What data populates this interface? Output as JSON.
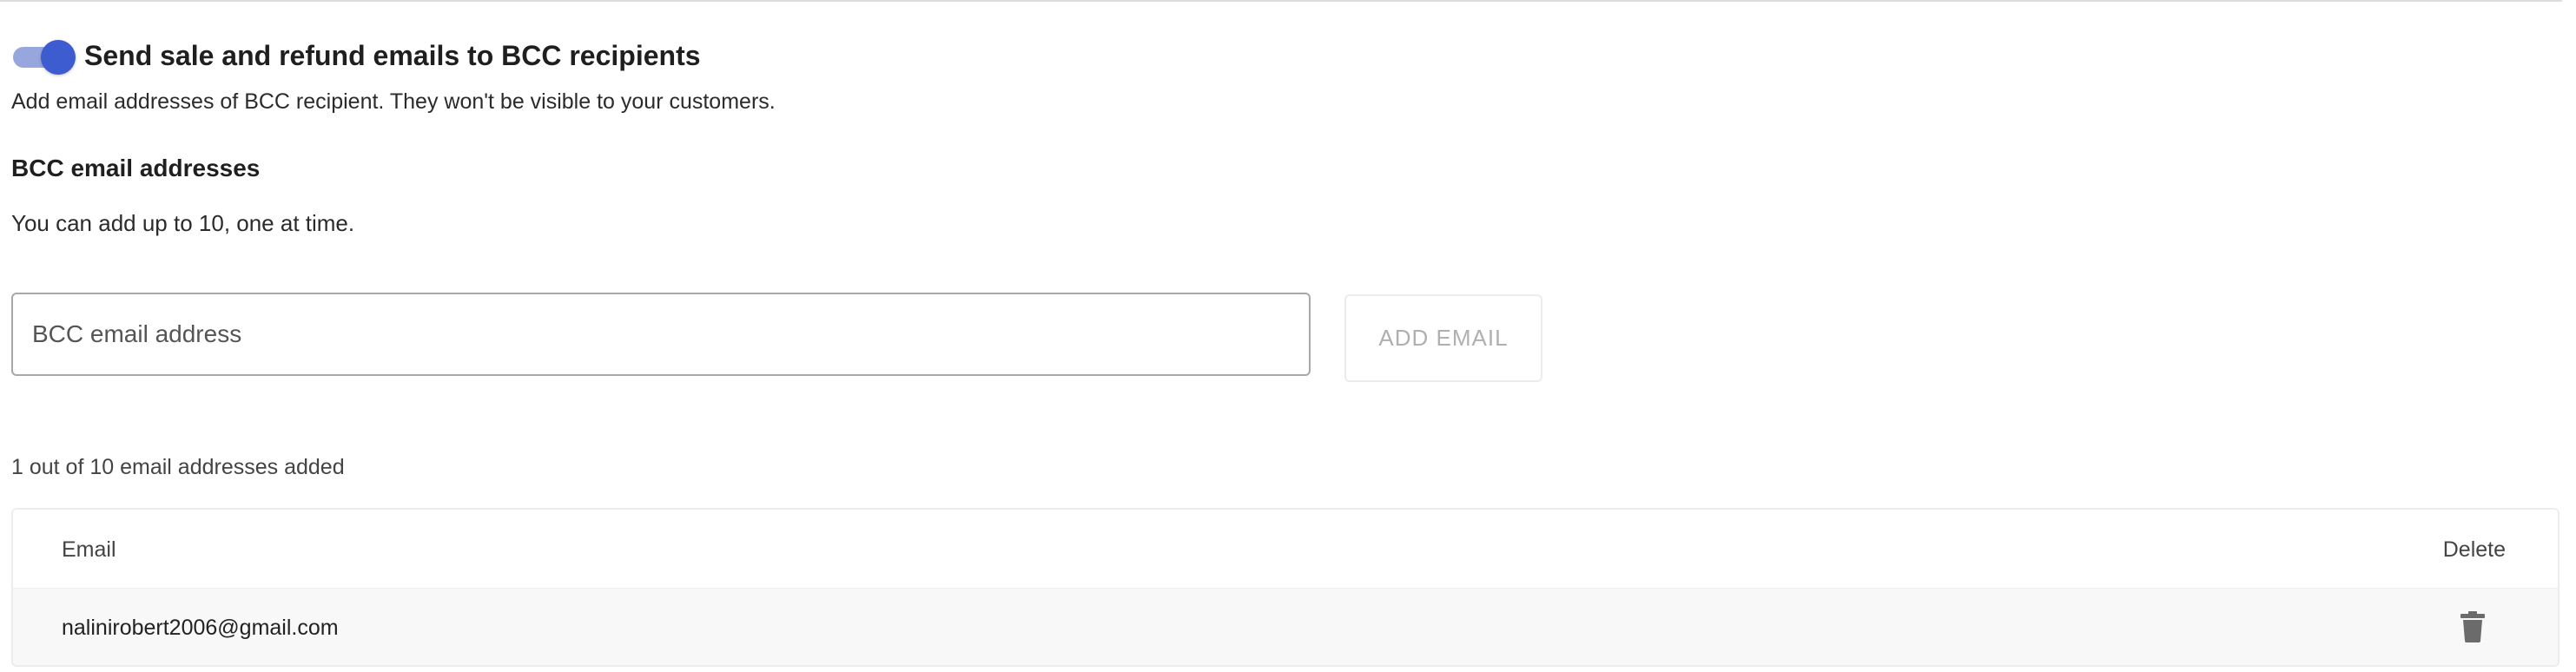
{
  "bcc_setting": {
    "toggle_on": true,
    "title": "Send sale and refund emails to BCC recipients",
    "description": "Add email addresses of BCC recipient. They won't be visible to your customers.",
    "section_heading": "BCC email addresses",
    "hint": "You can add up to 10, one at time."
  },
  "email_input": {
    "placeholder": "BCC email address",
    "value": ""
  },
  "add_button": {
    "label": "ADD EMAIL",
    "disabled": true
  },
  "count_text": "1 out of 10 email addresses added",
  "table": {
    "columns": [
      "Email",
      "Delete"
    ],
    "rows": [
      {
        "email": "nalinirobert2006@gmail.com",
        "action_icon": "trash-icon"
      }
    ]
  },
  "colors": {
    "toggle_track": "#98a6de",
    "toggle_knob": "#3c5ccf",
    "disabled_text": "#b0b0b0",
    "trash_icon": "#6b6b6b"
  }
}
